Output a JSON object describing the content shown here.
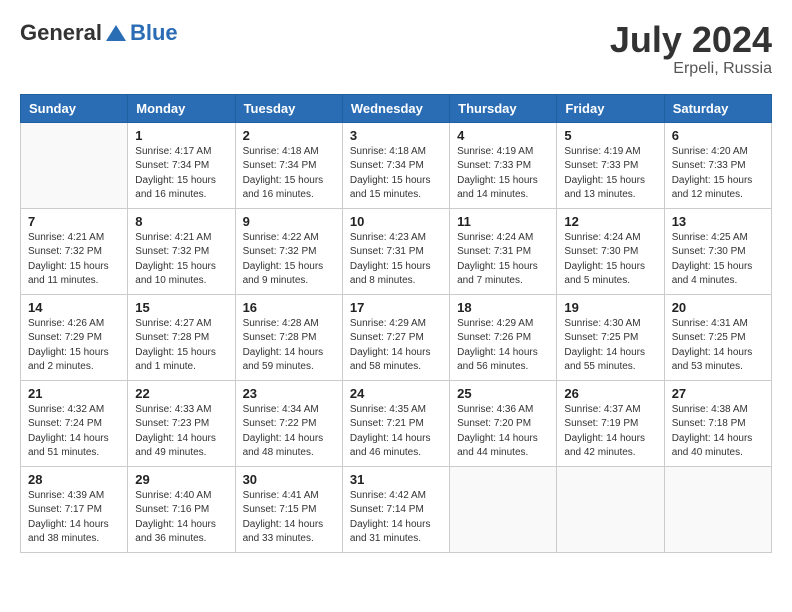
{
  "header": {
    "logo_general": "General",
    "logo_blue": "Blue",
    "month_year": "July 2024",
    "location": "Erpeli, Russia"
  },
  "days_of_week": [
    "Sunday",
    "Monday",
    "Tuesday",
    "Wednesday",
    "Thursday",
    "Friday",
    "Saturday"
  ],
  "weeks": [
    [
      {
        "day": "",
        "info": ""
      },
      {
        "day": "1",
        "info": "Sunrise: 4:17 AM\nSunset: 7:34 PM\nDaylight: 15 hours\nand 16 minutes."
      },
      {
        "day": "2",
        "info": "Sunrise: 4:18 AM\nSunset: 7:34 PM\nDaylight: 15 hours\nand 16 minutes."
      },
      {
        "day": "3",
        "info": "Sunrise: 4:18 AM\nSunset: 7:34 PM\nDaylight: 15 hours\nand 15 minutes."
      },
      {
        "day": "4",
        "info": "Sunrise: 4:19 AM\nSunset: 7:33 PM\nDaylight: 15 hours\nand 14 minutes."
      },
      {
        "day": "5",
        "info": "Sunrise: 4:19 AM\nSunset: 7:33 PM\nDaylight: 15 hours\nand 13 minutes."
      },
      {
        "day": "6",
        "info": "Sunrise: 4:20 AM\nSunset: 7:33 PM\nDaylight: 15 hours\nand 12 minutes."
      }
    ],
    [
      {
        "day": "7",
        "info": "Sunrise: 4:21 AM\nSunset: 7:32 PM\nDaylight: 15 hours\nand 11 minutes."
      },
      {
        "day": "8",
        "info": "Sunrise: 4:21 AM\nSunset: 7:32 PM\nDaylight: 15 hours\nand 10 minutes."
      },
      {
        "day": "9",
        "info": "Sunrise: 4:22 AM\nSunset: 7:32 PM\nDaylight: 15 hours\nand 9 minutes."
      },
      {
        "day": "10",
        "info": "Sunrise: 4:23 AM\nSunset: 7:31 PM\nDaylight: 15 hours\nand 8 minutes."
      },
      {
        "day": "11",
        "info": "Sunrise: 4:24 AM\nSunset: 7:31 PM\nDaylight: 15 hours\nand 7 minutes."
      },
      {
        "day": "12",
        "info": "Sunrise: 4:24 AM\nSunset: 7:30 PM\nDaylight: 15 hours\nand 5 minutes."
      },
      {
        "day": "13",
        "info": "Sunrise: 4:25 AM\nSunset: 7:30 PM\nDaylight: 15 hours\nand 4 minutes."
      }
    ],
    [
      {
        "day": "14",
        "info": "Sunrise: 4:26 AM\nSunset: 7:29 PM\nDaylight: 15 hours\nand 2 minutes."
      },
      {
        "day": "15",
        "info": "Sunrise: 4:27 AM\nSunset: 7:28 PM\nDaylight: 15 hours\nand 1 minute."
      },
      {
        "day": "16",
        "info": "Sunrise: 4:28 AM\nSunset: 7:28 PM\nDaylight: 14 hours\nand 59 minutes."
      },
      {
        "day": "17",
        "info": "Sunrise: 4:29 AM\nSunset: 7:27 PM\nDaylight: 14 hours\nand 58 minutes."
      },
      {
        "day": "18",
        "info": "Sunrise: 4:29 AM\nSunset: 7:26 PM\nDaylight: 14 hours\nand 56 minutes."
      },
      {
        "day": "19",
        "info": "Sunrise: 4:30 AM\nSunset: 7:25 PM\nDaylight: 14 hours\nand 55 minutes."
      },
      {
        "day": "20",
        "info": "Sunrise: 4:31 AM\nSunset: 7:25 PM\nDaylight: 14 hours\nand 53 minutes."
      }
    ],
    [
      {
        "day": "21",
        "info": "Sunrise: 4:32 AM\nSunset: 7:24 PM\nDaylight: 14 hours\nand 51 minutes."
      },
      {
        "day": "22",
        "info": "Sunrise: 4:33 AM\nSunset: 7:23 PM\nDaylight: 14 hours\nand 49 minutes."
      },
      {
        "day": "23",
        "info": "Sunrise: 4:34 AM\nSunset: 7:22 PM\nDaylight: 14 hours\nand 48 minutes."
      },
      {
        "day": "24",
        "info": "Sunrise: 4:35 AM\nSunset: 7:21 PM\nDaylight: 14 hours\nand 46 minutes."
      },
      {
        "day": "25",
        "info": "Sunrise: 4:36 AM\nSunset: 7:20 PM\nDaylight: 14 hours\nand 44 minutes."
      },
      {
        "day": "26",
        "info": "Sunrise: 4:37 AM\nSunset: 7:19 PM\nDaylight: 14 hours\nand 42 minutes."
      },
      {
        "day": "27",
        "info": "Sunrise: 4:38 AM\nSunset: 7:18 PM\nDaylight: 14 hours\nand 40 minutes."
      }
    ],
    [
      {
        "day": "28",
        "info": "Sunrise: 4:39 AM\nSunset: 7:17 PM\nDaylight: 14 hours\nand 38 minutes."
      },
      {
        "day": "29",
        "info": "Sunrise: 4:40 AM\nSunset: 7:16 PM\nDaylight: 14 hours\nand 36 minutes."
      },
      {
        "day": "30",
        "info": "Sunrise: 4:41 AM\nSunset: 7:15 PM\nDaylight: 14 hours\nand 33 minutes."
      },
      {
        "day": "31",
        "info": "Sunrise: 4:42 AM\nSunset: 7:14 PM\nDaylight: 14 hours\nand 31 minutes."
      },
      {
        "day": "",
        "info": ""
      },
      {
        "day": "",
        "info": ""
      },
      {
        "day": "",
        "info": ""
      }
    ]
  ]
}
